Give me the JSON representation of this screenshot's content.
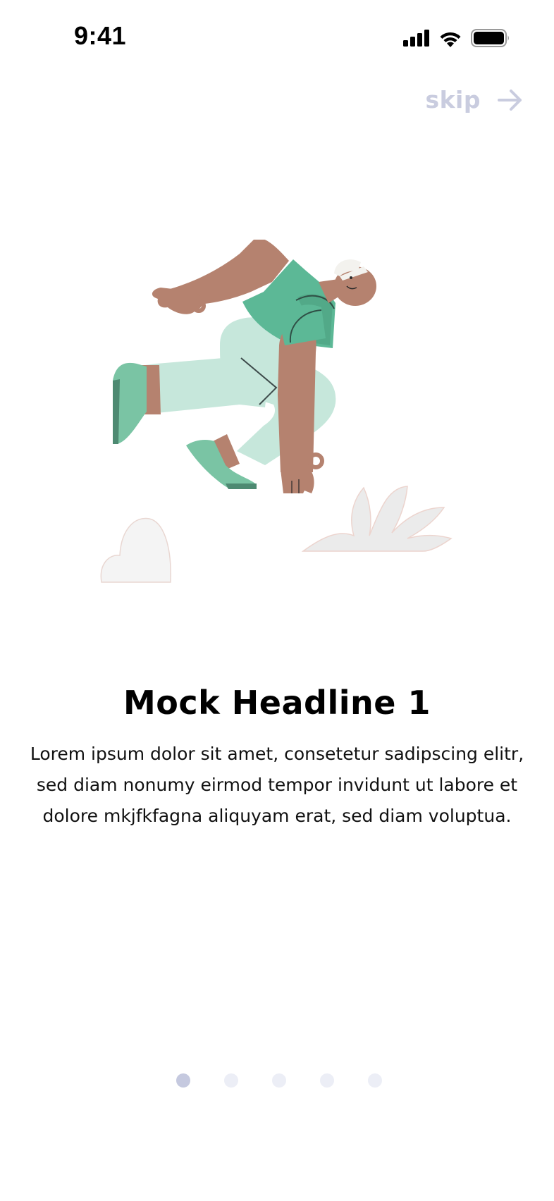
{
  "status_bar": {
    "time": "9:41",
    "icons": [
      "cellular-signal-icon",
      "wifi-icon",
      "battery-icon"
    ]
  },
  "skip": {
    "label": "skip",
    "icon": "arrow-right-icon",
    "color": "#c9ccdf"
  },
  "illustration": {
    "icon": "running-person-illustration",
    "colors": {
      "skin": "#b5826f",
      "shirt": "#5cb896",
      "pants": "#c6e7db",
      "shoe": "#7ac4a4",
      "plant": "#ebebeb"
    }
  },
  "content": {
    "headline": "Mock Headline 1",
    "body": "Lorem ipsum dolor sit amet, consetetur sadipscing elitr, sed diam nonumy eirmod tempor invidunt ut labore et dolore mkjfkfagna aliquyam erat, sed diam voluptua."
  },
  "pagination": {
    "total_pages": 5,
    "current_page": 1,
    "active_color": "#c5c9df",
    "inactive_color": "#eceef6"
  }
}
